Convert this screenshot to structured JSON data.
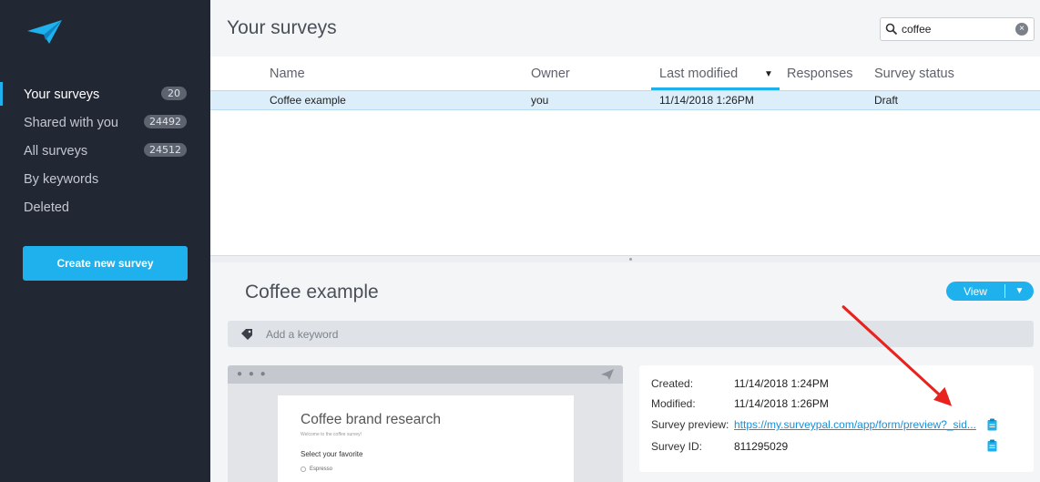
{
  "sidebar": {
    "items": [
      {
        "label": "Your surveys",
        "badge": "20",
        "active": true
      },
      {
        "label": "Shared with you",
        "badge": "24492"
      },
      {
        "label": "All surveys",
        "badge": "24512"
      },
      {
        "label": "By keywords"
      },
      {
        "label": "Deleted"
      }
    ],
    "create_label": "Create new survey"
  },
  "header": {
    "title": "Your surveys"
  },
  "search": {
    "value": "coffee"
  },
  "table": {
    "columns": [
      "Name",
      "Owner",
      "Last modified",
      "Responses",
      "Survey status"
    ],
    "sort_column": "Last modified",
    "rows": [
      {
        "name": "Coffee example",
        "owner": "you",
        "modified": "11/14/2018 1:26PM",
        "responses": "",
        "status": "Draft"
      }
    ]
  },
  "detail": {
    "title": "Coffee example",
    "view_label": "View",
    "keyword_placeholder": "Add a keyword",
    "preview": {
      "title": "Coffee brand research",
      "subtitle": "Welcome to the coffee survey!",
      "question": "Select your favorite",
      "options": [
        "Espresso"
      ]
    },
    "info": {
      "created_label": "Created:",
      "created_value": "11/14/2018 1:24PM",
      "modified_label": "Modified:",
      "modified_value": "11/14/2018 1:26PM",
      "preview_label": "Survey preview:",
      "preview_url": "https://my.surveypal.com/app/form/preview?_sid...",
      "id_label": "Survey ID:",
      "id_value": "811295029"
    }
  },
  "colors": {
    "accent": "#1fb1ee",
    "sidebar_bg": "#222734",
    "selected_row": "#dbeef9",
    "annotation_arrow": "#e8231f"
  },
  "icons": [
    "paper-plane-icon",
    "search-icon",
    "clear-icon",
    "chevron-down-icon",
    "tag-icon",
    "clipboard-icon"
  ]
}
